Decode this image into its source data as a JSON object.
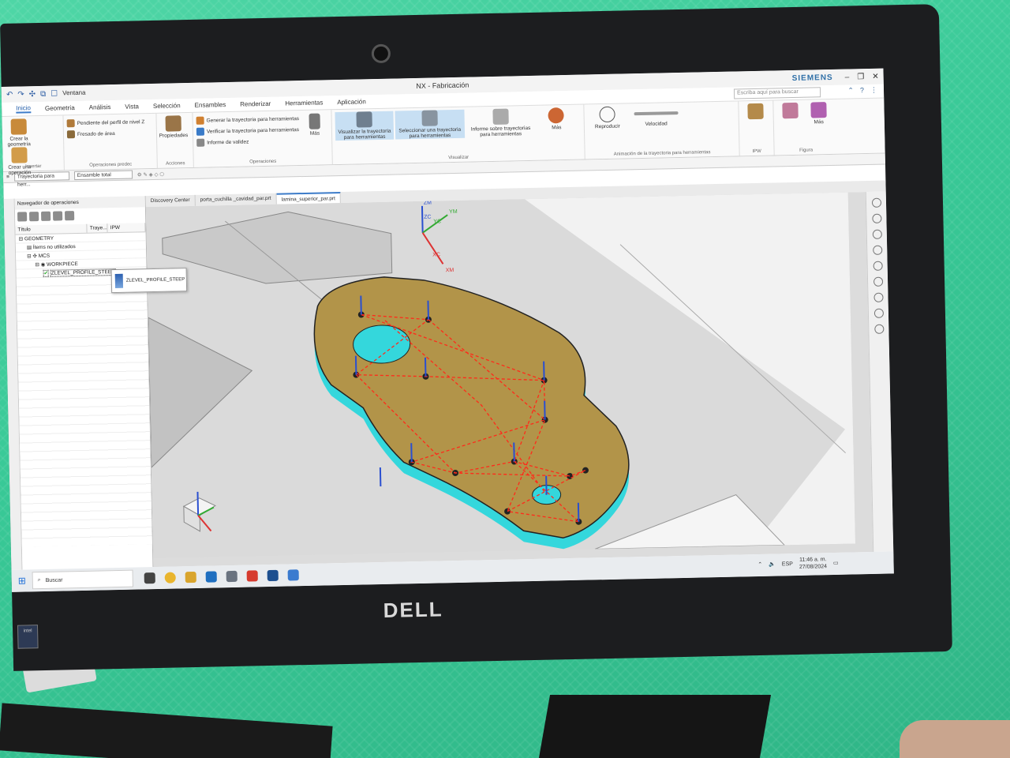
{
  "window": {
    "title": "NX - Fabricación",
    "brand": "SIEMENS",
    "search_placeholder": "Escriba aquí para buscar",
    "qat_window_label": "Ventana"
  },
  "menu": [
    "Inicio",
    "Geometría",
    "Análisis",
    "Vista",
    "Selección",
    "Ensambles",
    "Renderizar",
    "Herramientas",
    "Aplicación"
  ],
  "ribbon": {
    "insertar": {
      "group": "Insertar",
      "buttons": [
        "Crear la geometría",
        "Crear una operación"
      ]
    },
    "operaciones_predec": {
      "group": "Operaciones predec",
      "buttons": [
        "Pendiente del perfil de nivel Z",
        "Fresado de área"
      ]
    },
    "acciones": {
      "group": "Acciones",
      "buttons": [
        "Propiedades"
      ]
    },
    "operaciones": {
      "group": "Operaciones",
      "buttons": [
        "Generar la trayectoria para herramientas",
        "Verificar la trayectoria para herramientas",
        "Informe de validez",
        "Más"
      ]
    },
    "visualizar": {
      "group": "Visualizar",
      "buttons": [
        "Visualizar la trayectoria para herramientas",
        "Seleccionar una trayectoria para herramientas",
        "Informe sobre trayectorias para herramientas",
        "Más"
      ]
    },
    "animacion": {
      "group": "Animación de la trayectoria para herramientas",
      "buttons": [
        "Reproducir",
        "Velocidad"
      ]
    },
    "ipw": {
      "group": "IPW"
    },
    "figura": {
      "group": "Figura",
      "buttons": [
        "Más"
      ]
    }
  },
  "selection_bar": {
    "filter": "Trayectoria para herr...",
    "scope": "Ensamble total"
  },
  "navigator": {
    "title": "Navegador de operaciones",
    "columns": [
      "Título",
      "Traye...",
      "IPW"
    ],
    "tree": [
      {
        "label": "GEOMETRY",
        "indent": 0
      },
      {
        "label": "Ítems no utilizados",
        "indent": 1
      },
      {
        "label": "MCS",
        "indent": 1
      },
      {
        "label": "WORKPIECE",
        "indent": 2
      },
      {
        "label": "ZLEVEL_PROFILE_STEEP",
        "indent": 3
      }
    ],
    "tooltip": "ZLEVEL_PROFILE_STEEP"
  },
  "tabs": [
    "Discovery Center",
    "porta_cuchilla _cavidad_par.prt",
    "lamina_superior_par.prt"
  ],
  "axes": {
    "zm": "ZM",
    "zc": "ZC",
    "yc": "YC",
    "ym": "YM",
    "xc": "XC",
    "xm": "XM"
  },
  "taskbar": {
    "search": "Buscar",
    "lang": "ESP",
    "time": "11:46 a. m.",
    "date": "27/08/2024"
  },
  "monitor_brand": "DELL",
  "colors": {
    "part_top": "#b29449",
    "part_side": "#34d7dc",
    "toolpath": "#ff2a1a",
    "accent": "#3d7cc9",
    "backdrop": "#3cc895"
  }
}
